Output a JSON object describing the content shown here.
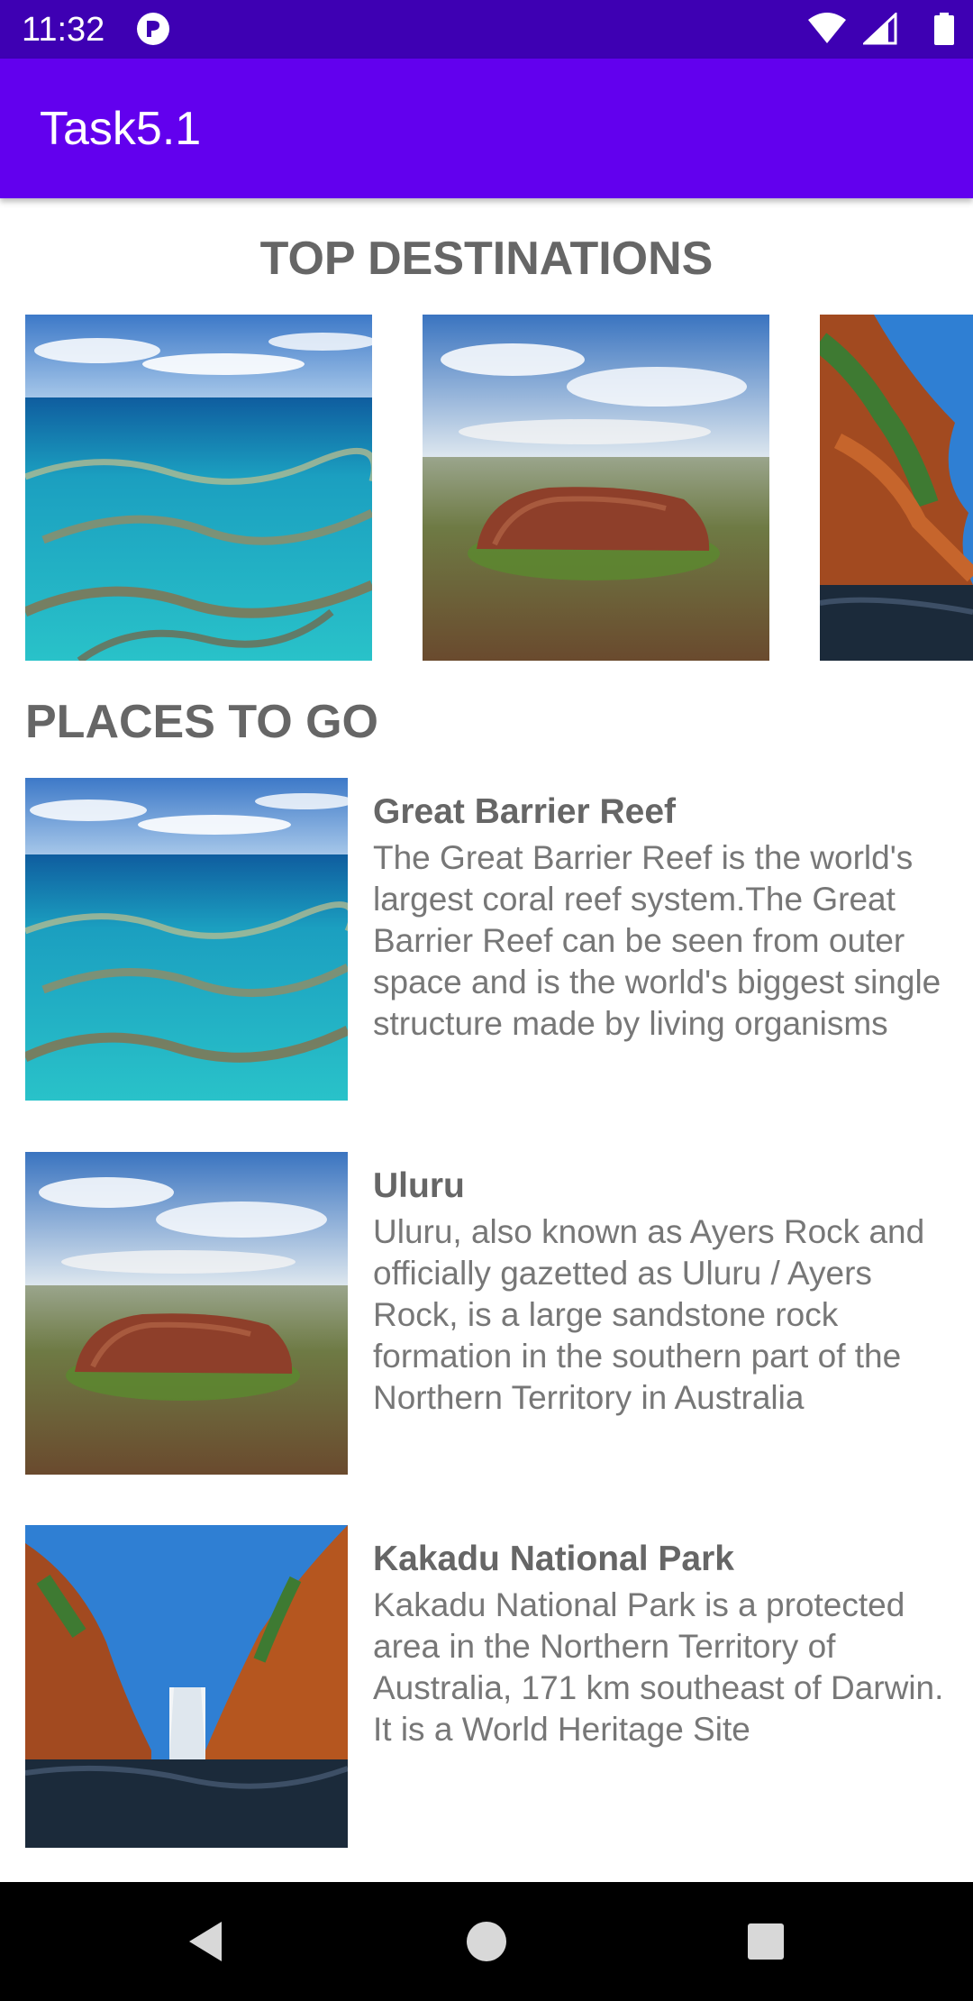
{
  "status_bar": {
    "time": "11:32",
    "icons": [
      "notification-icon",
      "wifi-icon",
      "signal-icon",
      "battery-icon"
    ]
  },
  "app_bar": {
    "title": "Task5.1"
  },
  "top_destinations": {
    "title": "TOP DESTINATIONS",
    "tiles": [
      {
        "icon": "great-barrier-reef-image"
      },
      {
        "icon": "uluru-image"
      },
      {
        "icon": "kakadu-image"
      }
    ]
  },
  "places": {
    "title": "PLACES TO GO",
    "items": [
      {
        "name": "Great Barrier Reef",
        "description": "The Great Barrier Reef is the world's largest coral reef system.The Great Barrier Reef can be seen from outer space and is the world's biggest single structure made by living organisms",
        "icon": "great-barrier-reef-image"
      },
      {
        "name": "Uluru",
        "description": "Uluru, also known as Ayers Rock and officially gazetted as Uluru / Ayers Rock, is a large sandstone rock formation in the southern part of the Northern Territory in Australia",
        "icon": "uluru-image"
      },
      {
        "name": "Kakadu National Park",
        "description": "Kakadu National Park is a protected area in the Northern Territory of Australia, 171 km southeast of Darwin. It is a World Heritage Site",
        "icon": "kakadu-image"
      }
    ]
  },
  "nav_bar": {
    "buttons": [
      "back-icon",
      "home-icon",
      "recents-icon"
    ]
  },
  "colors": {
    "status_bar": "#3e00b3",
    "app_bar": "#6200ee",
    "heading_text": "#666666",
    "body_text": "#777777"
  }
}
